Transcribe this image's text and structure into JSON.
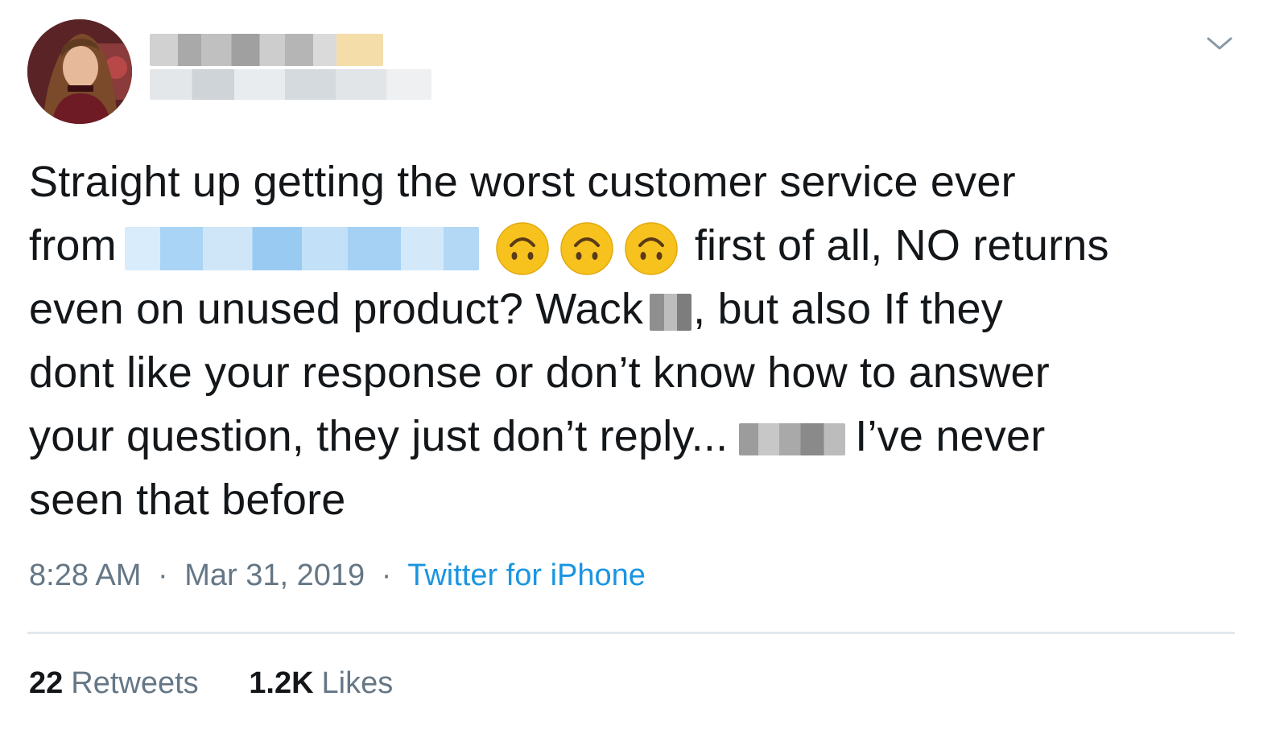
{
  "tweet": {
    "text_lines": [
      "Straight up getting the worst customer service ever",
      "from",
      "first of all, NO returns",
      "even on unused product? Wack",
      ",  but also If they",
      "dont like your response or don’t know how to answer",
      "your question, they just don’t reply...",
      "I’ve never",
      "seen that before"
    ],
    "emoji": [
      "upside-down-face",
      "upside-down-face",
      "upside-down-face"
    ],
    "time": "8:28 AM",
    "date": "Mar 31, 2019",
    "separator": "·",
    "source": "Twitter for iPhone",
    "retweets_count": "22",
    "retweets_label": "Retweets",
    "likes_count": "1.2K",
    "likes_label": "Likes"
  },
  "icons": {
    "menu": "chevron-down-icon"
  },
  "colors": {
    "text": "#14171a",
    "secondary": "#657786",
    "link": "#1b95e0",
    "divider": "#e1e8ed",
    "emoji": "#f7c21e"
  }
}
